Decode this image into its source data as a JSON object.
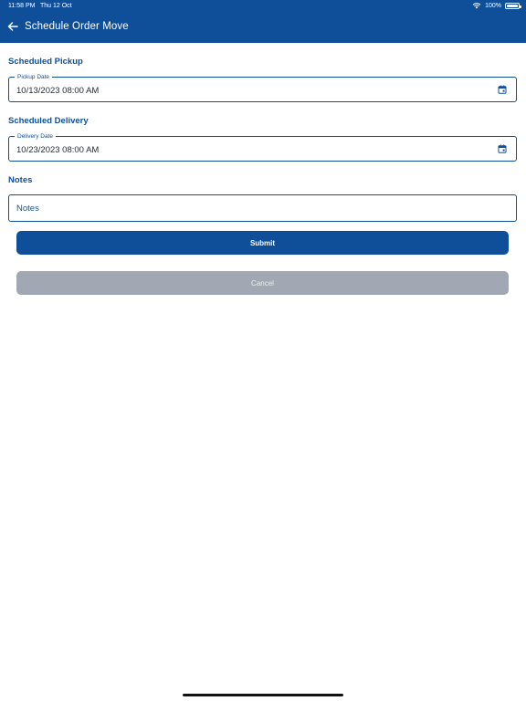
{
  "status_bar": {
    "time": "11:58 PM",
    "date": "Thu 12 Oct",
    "battery": "100%"
  },
  "header": {
    "title": "Schedule Order Move",
    "back_icon": "arrow-left-icon"
  },
  "pickup": {
    "section_title": "Scheduled Pickup",
    "field_label": "Pickup Date",
    "value": "10/13/2023 08:00 AM",
    "icon": "calendar-icon"
  },
  "delivery": {
    "section_title": "Scheduled Delivery",
    "field_label": "Delivery Date",
    "value": "10/23/2023 08:00 AM",
    "icon": "calendar-icon"
  },
  "notes": {
    "section_title": "Notes",
    "placeholder": "Notes",
    "value": ""
  },
  "actions": {
    "submit_label": "Submit",
    "cancel_label": "Cancel"
  },
  "colors": {
    "primary": "#0f4f9a",
    "cancel_bg": "#a2a8b3"
  }
}
